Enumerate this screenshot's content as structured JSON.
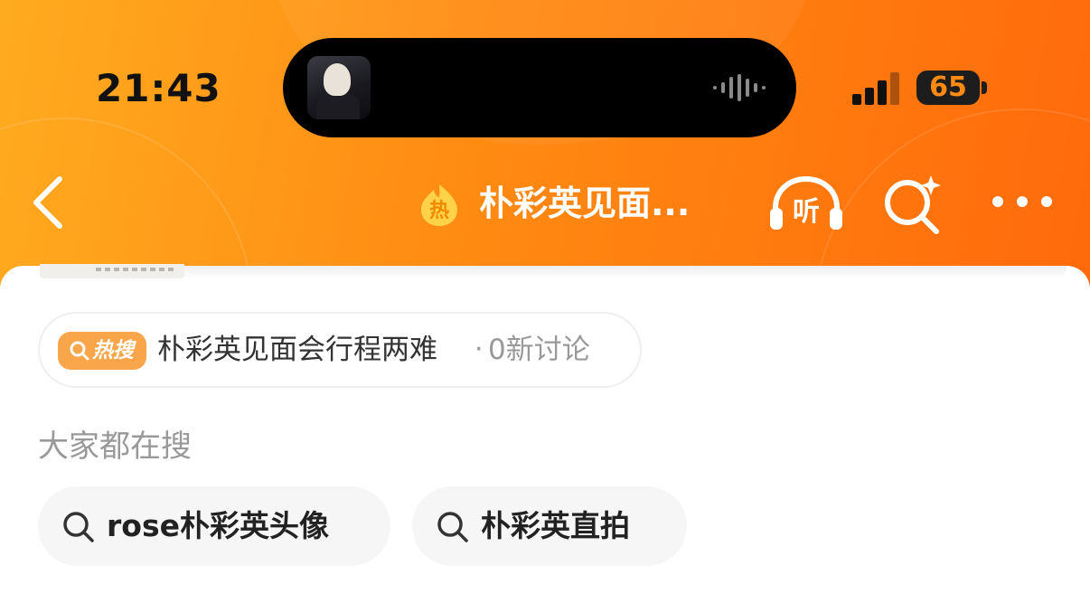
{
  "status_bar": {
    "time": "21:43",
    "battery": "65",
    "icons": [
      "now-playing-thumbnail",
      "audio-waveform-icon",
      "cellular-signal-icon",
      "battery-icon"
    ]
  },
  "nav": {
    "title": "朴彩英见面...",
    "listen_label": "听",
    "icons": [
      "back-chevron-icon",
      "hot-flame-badge-icon",
      "listen-headphones-icon",
      "search-sparkle-icon",
      "more-dots-icon"
    ]
  },
  "hot_search": {
    "tag": "热搜",
    "topic": "朴彩英见面会行程两难",
    "separator": "·",
    "meta": "0新讨论"
  },
  "related": {
    "heading": "大家都在搜",
    "items": [
      {
        "label": "rose朴彩英头像"
      },
      {
        "label": "朴彩英直拍"
      }
    ]
  },
  "colors": {
    "header_start": "#ffab1f",
    "header_end": "#ff6a0b",
    "tag_orange": "#f9a54a",
    "battery_text": "#ff8a12"
  }
}
